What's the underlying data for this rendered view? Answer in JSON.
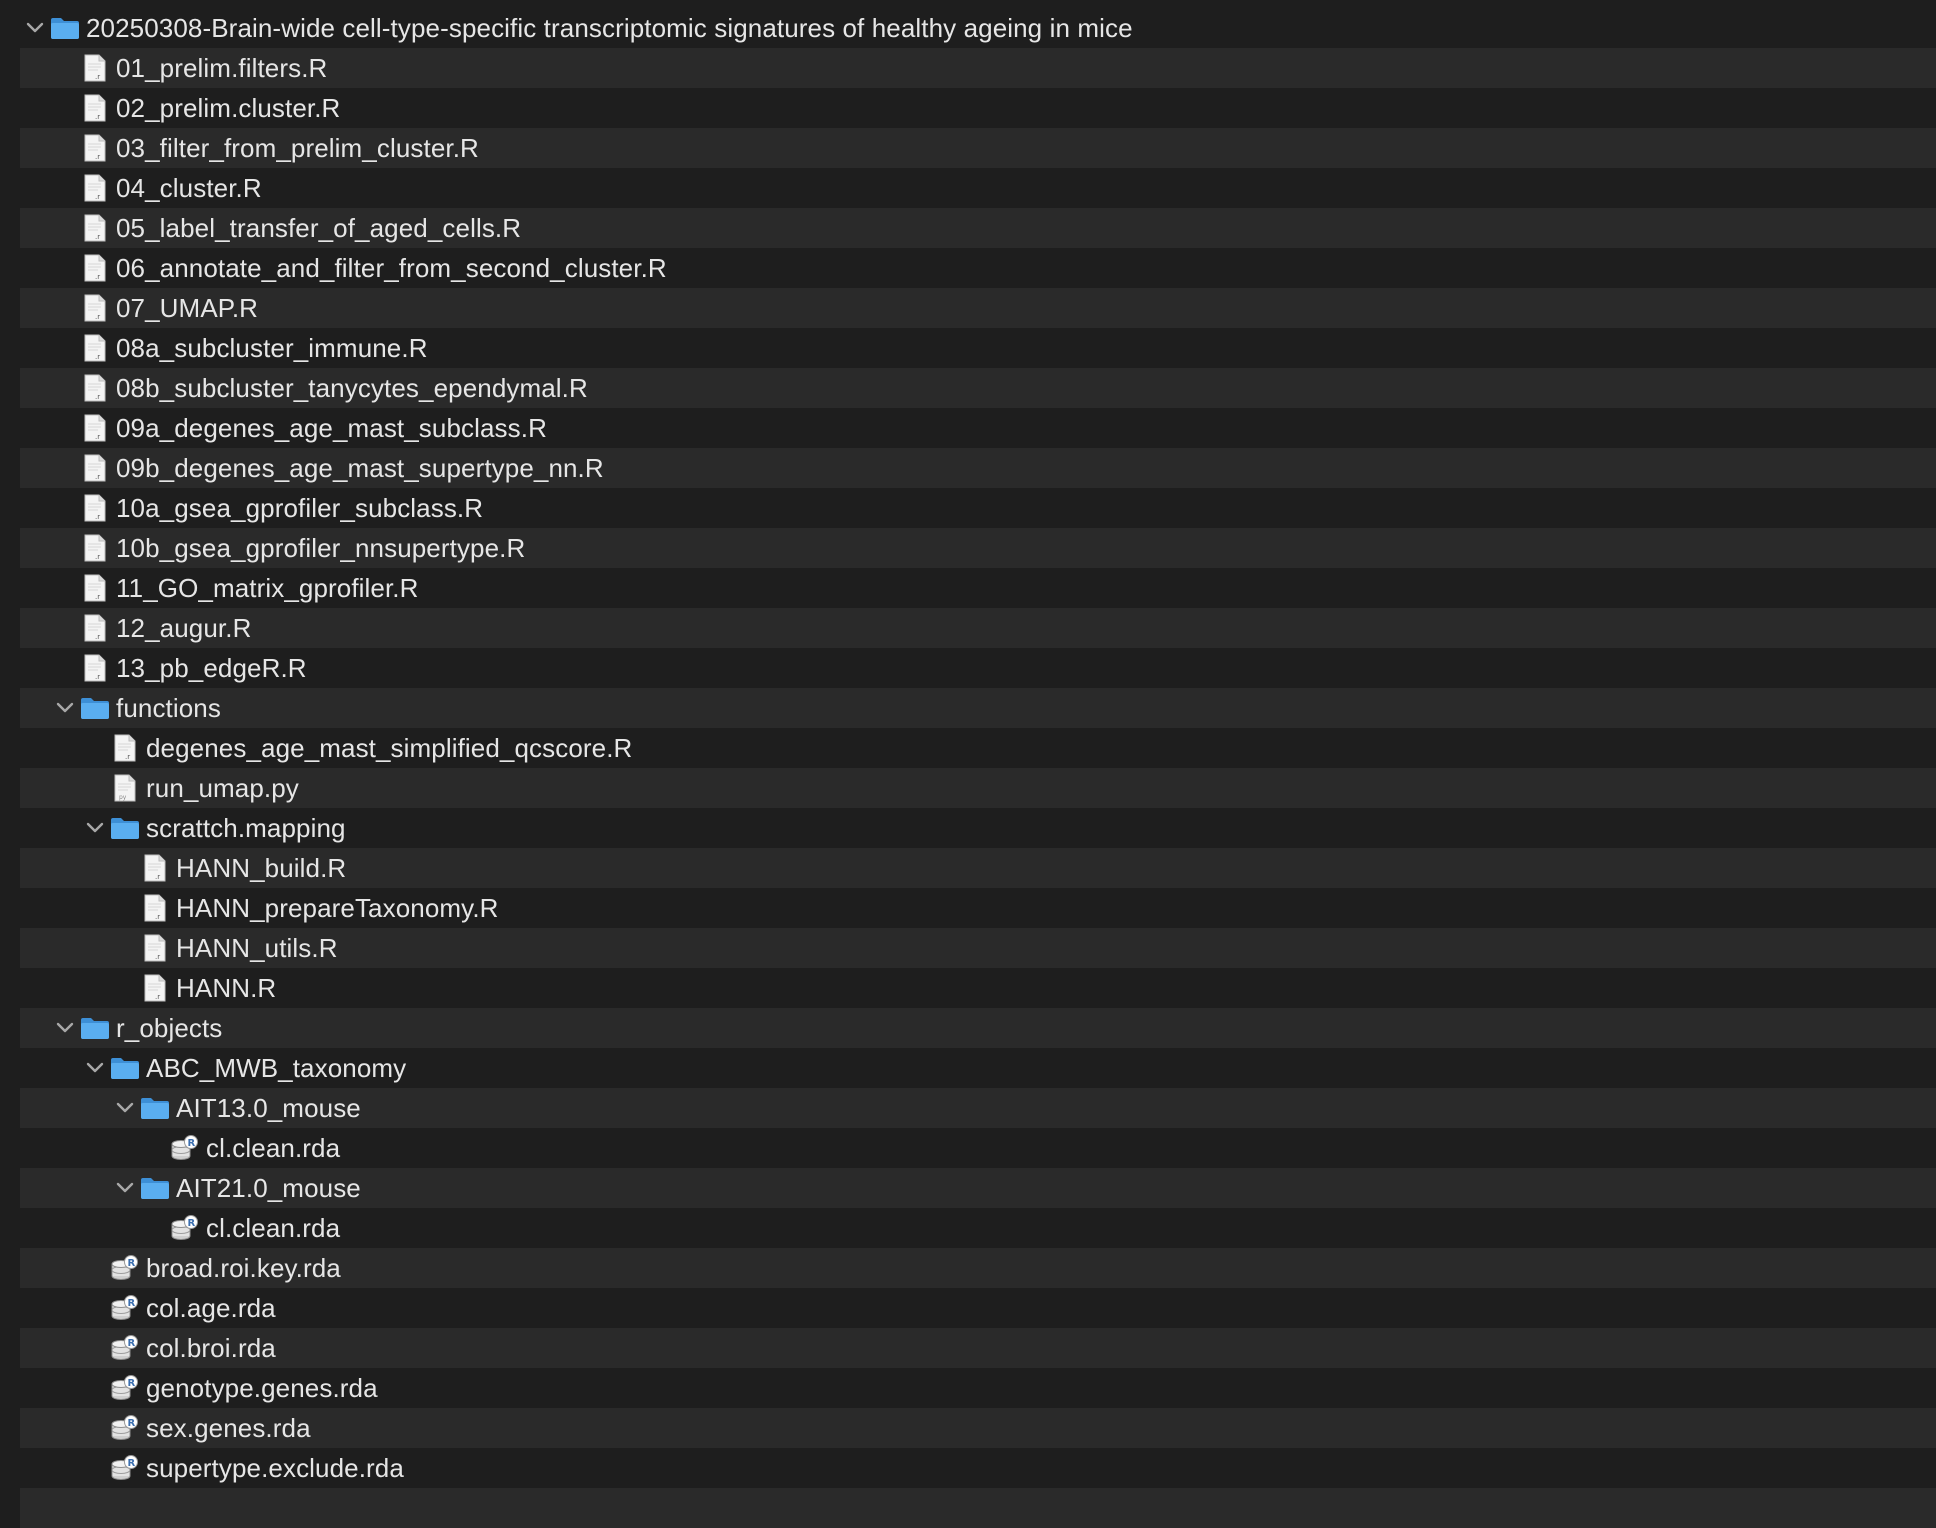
{
  "tree": {
    "rows": [
      {
        "label": "20250308-Brain-wide cell-type-specific transcriptomic signatures of healthy ageing in mice",
        "depth": 0,
        "kind": "folder",
        "expanded": true,
        "icon": "folder-icon"
      },
      {
        "label": "01_prelim.filters.R",
        "depth": 1,
        "kind": "r-file",
        "icon": "r-script-file-icon"
      },
      {
        "label": "02_prelim.cluster.R",
        "depth": 1,
        "kind": "r-file",
        "icon": "r-script-file-icon"
      },
      {
        "label": "03_filter_from_prelim_cluster.R",
        "depth": 1,
        "kind": "r-file",
        "icon": "r-script-file-icon"
      },
      {
        "label": "04_cluster.R",
        "depth": 1,
        "kind": "r-file",
        "icon": "r-script-file-icon"
      },
      {
        "label": "05_label_transfer_of_aged_cells.R",
        "depth": 1,
        "kind": "r-file",
        "icon": "r-script-file-icon"
      },
      {
        "label": "06_annotate_and_filter_from_second_cluster.R",
        "depth": 1,
        "kind": "r-file",
        "icon": "r-script-file-icon"
      },
      {
        "label": "07_UMAP.R",
        "depth": 1,
        "kind": "r-file",
        "icon": "r-script-file-icon"
      },
      {
        "label": "08a_subcluster_immune.R",
        "depth": 1,
        "kind": "r-file",
        "icon": "r-script-file-icon"
      },
      {
        "label": "08b_subcluster_tanycytes_ependymal.R",
        "depth": 1,
        "kind": "r-file",
        "icon": "r-script-file-icon"
      },
      {
        "label": "09a_degenes_age_mast_subclass.R",
        "depth": 1,
        "kind": "r-file",
        "icon": "r-script-file-icon"
      },
      {
        "label": "09b_degenes_age_mast_supertype_nn.R",
        "depth": 1,
        "kind": "r-file",
        "icon": "r-script-file-icon"
      },
      {
        "label": "10a_gsea_gprofiler_subclass.R",
        "depth": 1,
        "kind": "r-file",
        "icon": "r-script-file-icon"
      },
      {
        "label": "10b_gsea_gprofiler_nnsupertype.R",
        "depth": 1,
        "kind": "r-file",
        "icon": "r-script-file-icon"
      },
      {
        "label": "11_GO_matrix_gprofiler.R",
        "depth": 1,
        "kind": "r-file",
        "icon": "r-script-file-icon"
      },
      {
        "label": "12_augur.R",
        "depth": 1,
        "kind": "r-file",
        "icon": "r-script-file-icon"
      },
      {
        "label": "13_pb_edgeR.R",
        "depth": 1,
        "kind": "r-file",
        "icon": "r-script-file-icon"
      },
      {
        "label": "functions",
        "depth": 1,
        "kind": "folder",
        "expanded": true,
        "icon": "folder-icon"
      },
      {
        "label": "degenes_age_mast_simplified_qcscore.R",
        "depth": 2,
        "kind": "r-file",
        "icon": "r-script-file-icon"
      },
      {
        "label": "run_umap.py",
        "depth": 2,
        "kind": "py-file",
        "icon": "python-file-icon"
      },
      {
        "label": "scrattch.mapping",
        "depth": 2,
        "kind": "folder",
        "expanded": true,
        "icon": "folder-icon"
      },
      {
        "label": "HANN_build.R",
        "depth": 3,
        "kind": "r-file",
        "icon": "r-script-file-icon"
      },
      {
        "label": "HANN_prepareTaxonomy.R",
        "depth": 3,
        "kind": "r-file",
        "icon": "r-script-file-icon"
      },
      {
        "label": "HANN_utils.R",
        "depth": 3,
        "kind": "r-file",
        "icon": "r-script-file-icon"
      },
      {
        "label": "HANN.R",
        "depth": 3,
        "kind": "r-file",
        "icon": "r-script-file-icon"
      },
      {
        "label": "r_objects",
        "depth": 1,
        "kind": "folder",
        "expanded": true,
        "icon": "folder-icon"
      },
      {
        "label": "ABC_MWB_taxonomy",
        "depth": 2,
        "kind": "folder",
        "expanded": true,
        "icon": "folder-icon"
      },
      {
        "label": "AIT13.0_mouse",
        "depth": 3,
        "kind": "folder",
        "expanded": true,
        "icon": "folder-icon"
      },
      {
        "label": "cl.clean.rda",
        "depth": 4,
        "kind": "rda-file",
        "icon": "r-data-file-icon"
      },
      {
        "label": "AIT21.0_mouse",
        "depth": 3,
        "kind": "folder",
        "expanded": true,
        "icon": "folder-icon"
      },
      {
        "label": "cl.clean.rda",
        "depth": 4,
        "kind": "rda-file",
        "icon": "r-data-file-icon"
      },
      {
        "label": "broad.roi.key.rda",
        "depth": 2,
        "kind": "rda-file",
        "icon": "r-data-file-icon"
      },
      {
        "label": "col.age.rda",
        "depth": 2,
        "kind": "rda-file",
        "icon": "r-data-file-icon"
      },
      {
        "label": "col.broi.rda",
        "depth": 2,
        "kind": "rda-file",
        "icon": "r-data-file-icon"
      },
      {
        "label": "genotype.genes.rda",
        "depth": 2,
        "kind": "rda-file",
        "icon": "r-data-file-icon"
      },
      {
        "label": "sex.genes.rda",
        "depth": 2,
        "kind": "rda-file",
        "icon": "r-data-file-icon"
      },
      {
        "label": "supertype.exclude.rda",
        "depth": 2,
        "kind": "rda-file",
        "icon": "r-data-file-icon"
      },
      {
        "label": "",
        "depth": 0,
        "kind": "empty",
        "icon": ""
      }
    ]
  },
  "colors": {
    "background": "#1e1e1e",
    "row_alt": "#2a2a2a",
    "text": "#e6e6e6",
    "folder": "#5aaef0",
    "chevron": "#a8a8a8"
  }
}
